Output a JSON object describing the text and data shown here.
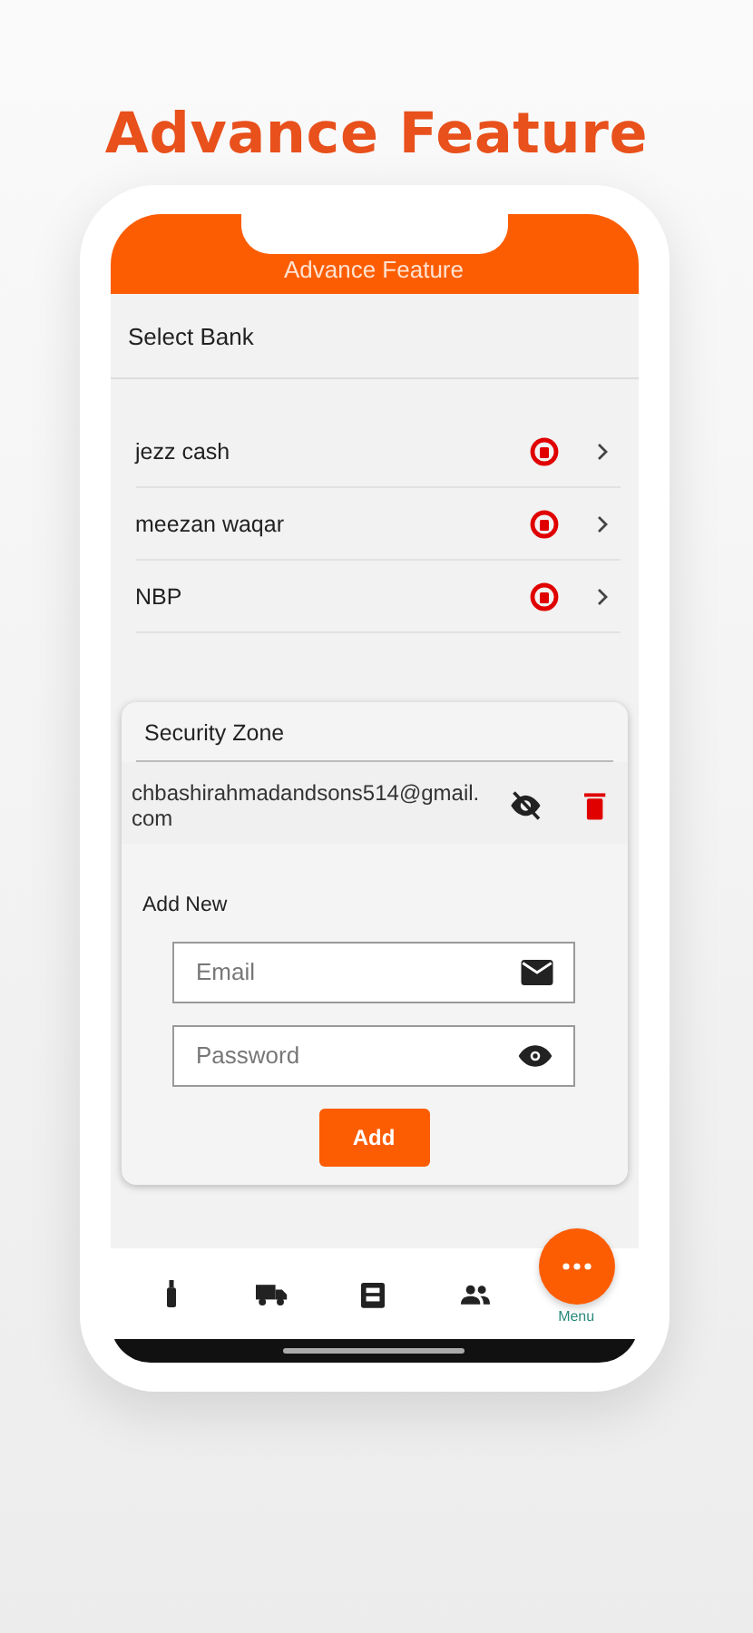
{
  "headline": "Advance Feature",
  "app_bar": {
    "title": "Advance Feature"
  },
  "select_bank": {
    "label": "Select Bank"
  },
  "banks": [
    {
      "name": "jezz cash"
    },
    {
      "name": "meezan waqar"
    },
    {
      "name": "NBP"
    }
  ],
  "security_zone": {
    "title": "Security Zone",
    "accounts": [
      {
        "email": "chbashirahmadandsons514@gmail.com"
      }
    ],
    "add_new": {
      "title": "Add New",
      "email": {
        "placeholder": "Email"
      },
      "password": {
        "placeholder": "Password"
      },
      "button": "Add"
    }
  },
  "nav": [
    {
      "kind": "bottle",
      "selected": false
    },
    {
      "kind": "truck",
      "selected": false
    },
    {
      "kind": "clipboard",
      "selected": false
    },
    {
      "kind": "people",
      "selected": false
    },
    {
      "kind": "menu",
      "label": "Menu",
      "selected": true
    }
  ]
}
